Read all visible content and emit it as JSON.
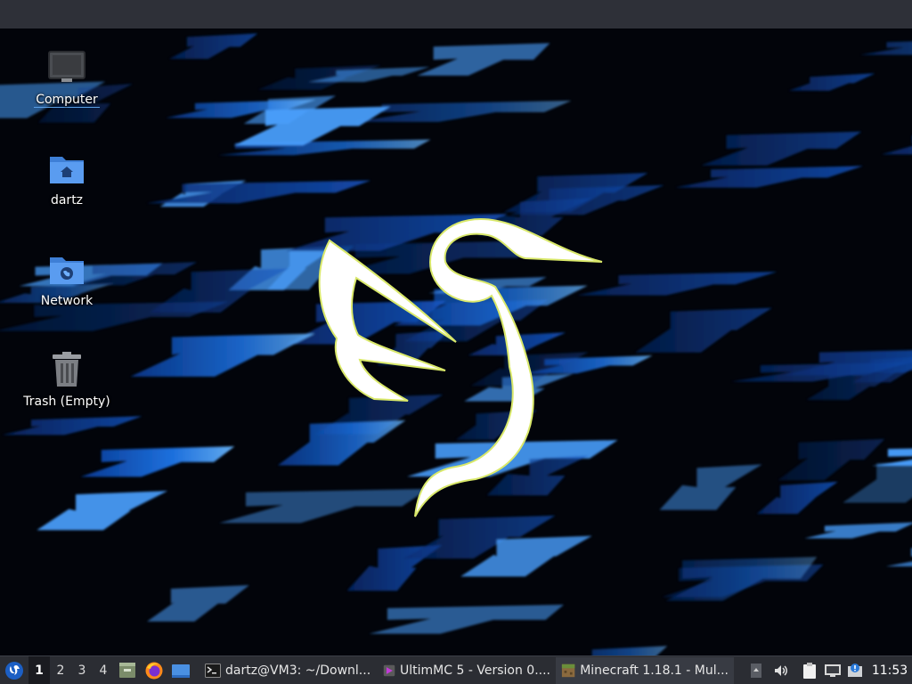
{
  "desktop": {
    "icons": [
      {
        "label": "Computer",
        "icon": "monitor-icon"
      },
      {
        "label": "dartz",
        "icon": "home-folder-icon"
      },
      {
        "label": "Network",
        "icon": "network-folder-icon"
      },
      {
        "label": "Trash (Empty)",
        "icon": "trash-icon"
      }
    ]
  },
  "taskbar": {
    "start_icon": "lubuntu-start-icon",
    "workspaces": [
      "1",
      "2",
      "3",
      "4"
    ],
    "active_workspace": "1",
    "launchers": [
      "file-manager-icon",
      "firefox-icon",
      "show-desktop-icon"
    ],
    "tasks": [
      {
        "label": "dartz@VM3: ~/Downl...",
        "icon": "terminal-icon"
      },
      {
        "label": "UltimMC 5 - Version 0....",
        "icon": "ultimmc-icon"
      },
      {
        "label": "Minecraft 1.18.1 - Mul...",
        "icon": "minecraft-icon"
      }
    ],
    "tray_icons": [
      "tray-arrow-icon",
      "volume-icon",
      "clipboard-icon",
      "network-status-icon",
      "update-notifier-icon"
    ],
    "clock": "11:53"
  },
  "colors": {
    "wallpaper_blue": "#1e6fe8",
    "wallpaper_light": "#7fc4ff",
    "logo_outline": "#d9e86a",
    "taskbar_bg": "#2b2d33"
  }
}
